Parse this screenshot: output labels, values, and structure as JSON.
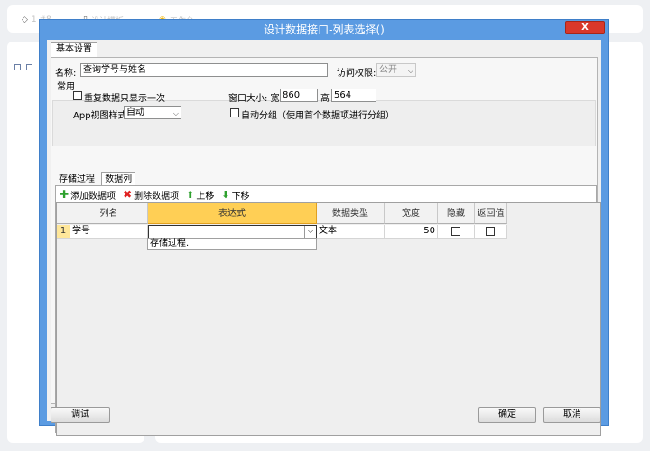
{
  "background": {
    "top_items": [
      "1  #8",
      "设计模板",
      "工作台"
    ]
  },
  "dialog": {
    "title": "设计数据接口-列表选择()",
    "close_label": "X",
    "tab_basic": "基本设置",
    "name_label": "名称:",
    "name_value": "查询学号与姓名",
    "access_label": "访问权限:",
    "access_value": "公开",
    "group_label": "常用",
    "show_once_label": "重复数据只显示一次",
    "window_size_label": "窗口大小: 宽",
    "width_value": "860",
    "height_label": "高",
    "height_value": "564",
    "app_view_label": "App视图样式",
    "app_view_value": "自动",
    "auto_group_label": "自动分组（使用首个数据项进行分组）",
    "subtabs": [
      "存储过程",
      "数据列"
    ],
    "toolbar": {
      "add": "添加数据项",
      "delete": "删除数据项",
      "up": "上移",
      "down": "下移"
    },
    "grid": {
      "headers": [
        "列名",
        "表达式",
        "数据类型",
        "宽度",
        "隐藏",
        "返回值"
      ],
      "rows": [
        {
          "num": "1",
          "name": "学号",
          "expression": "",
          "type": "文本",
          "width": "50",
          "hidden": false,
          "return": false
        }
      ],
      "dropdown_option": "存储过程."
    },
    "buttons": {
      "debug": "调试",
      "ok": "确定",
      "cancel": "取消"
    }
  }
}
